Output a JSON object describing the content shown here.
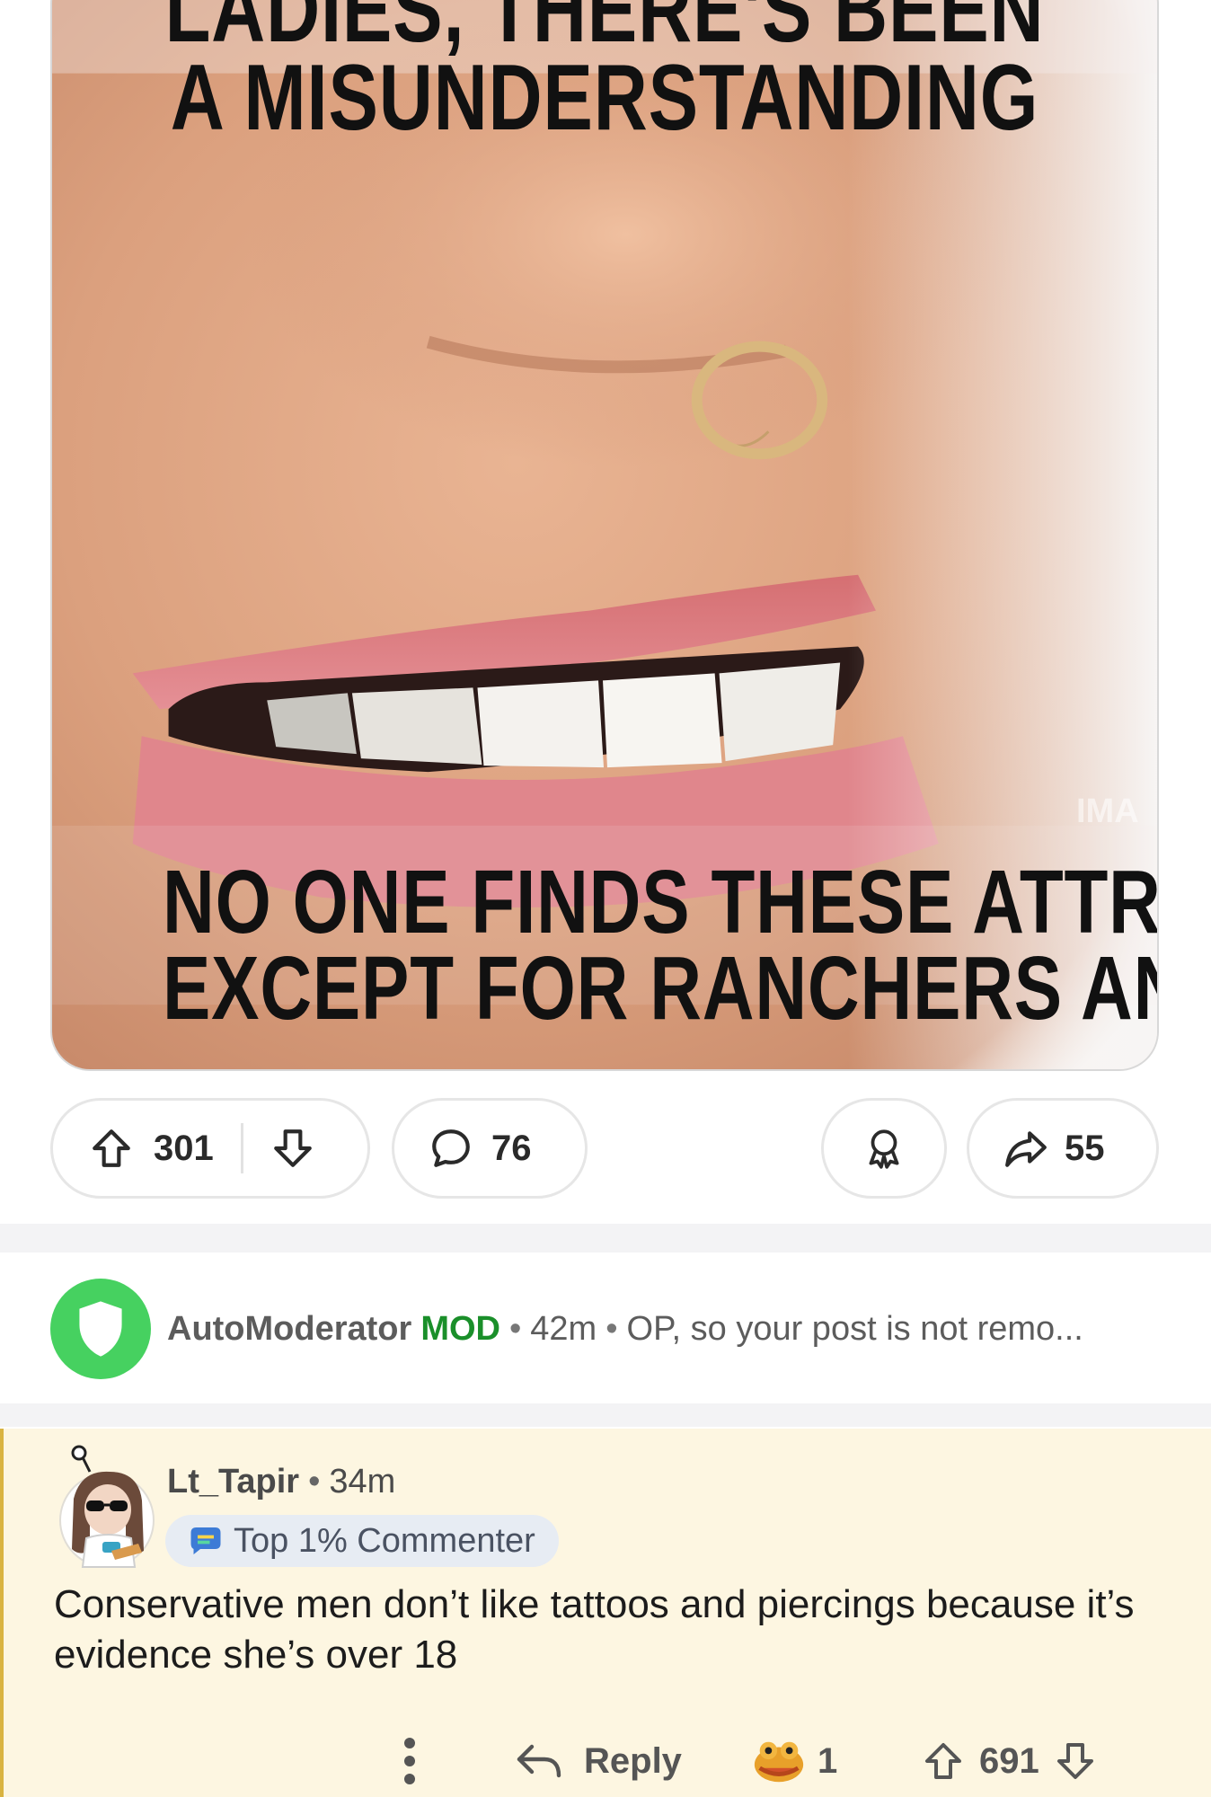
{
  "post": {
    "meme": {
      "top_lines": [
        "LADIES, THERE'S BEEN",
        "A MISUNDERSTANDING"
      ],
      "bottom_lines": [
        "NO ONE FINDS THESE ATTRACTIVE",
        "EXCEPT FOR RANCHERS AND CATTLE"
      ],
      "watermark": "IMA"
    },
    "actions": {
      "upvotes": "301",
      "comments": "76",
      "shares": "55"
    }
  },
  "automod": {
    "username": "AutoModerator",
    "badge": "MOD",
    "time": "42m",
    "preview": "OP, so your post is not remo..."
  },
  "comment": {
    "username": "Lt_Tapir",
    "time": "34m",
    "flair": "Top 1% Commenter",
    "body": "Conservative men don’t like tattoos and piercings because it’s evidence she’s over 18",
    "reply_label": "Reply",
    "award_count": "1",
    "score": "691"
  },
  "colors": {
    "mod_green": "#46d160",
    "mod_badge": "#1a8f2a",
    "highlight_bg": "#fdf6e1",
    "highlight_border": "#d9b341",
    "flair_bg": "#e7ecf3"
  },
  "icons": {
    "upvote": "arrow-up-icon",
    "downvote": "arrow-down-icon",
    "comment": "speech-bubble-icon",
    "award": "award-ribbon-icon",
    "share": "share-arrow-icon",
    "mod": "shield-icon",
    "more": "vertical-dots-icon",
    "reply": "reply-arrow-icon"
  }
}
